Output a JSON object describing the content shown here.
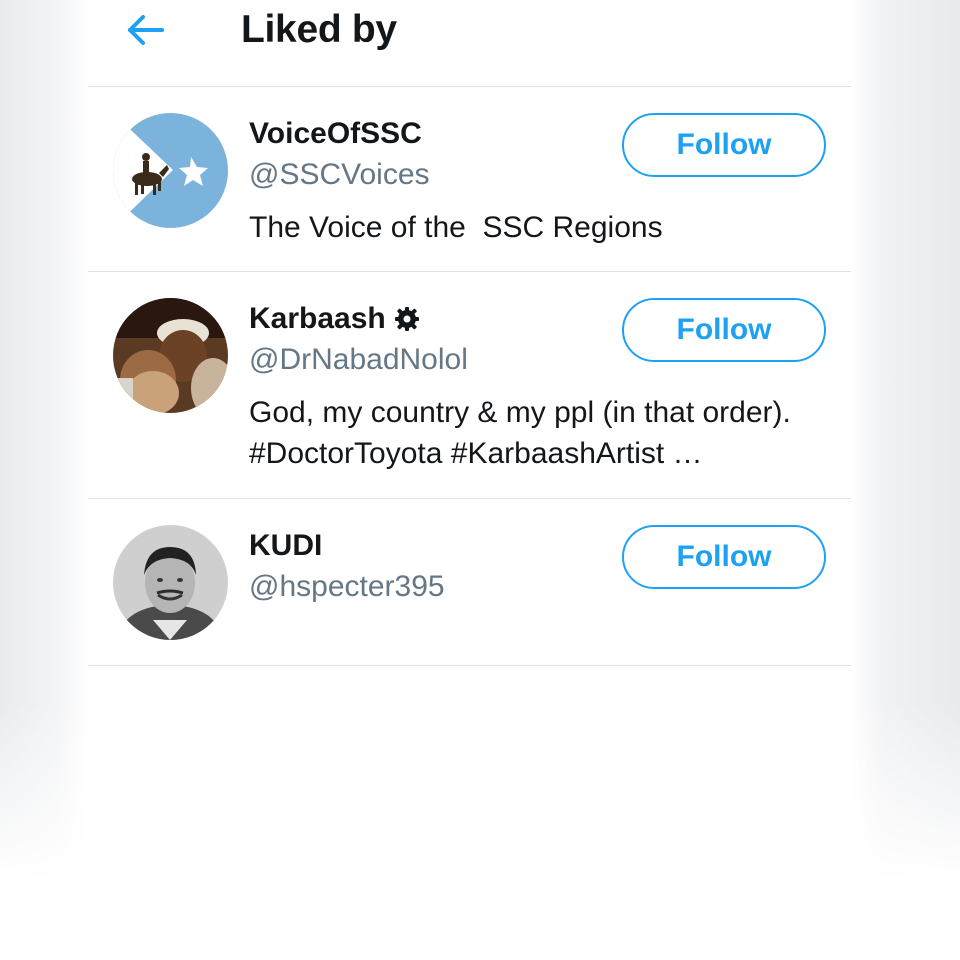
{
  "header": {
    "title": "Liked by",
    "back_icon": "back-arrow-icon"
  },
  "users": [
    {
      "name": "VoiceOfSSC",
      "handle": "@SSCVoices",
      "bio": "The Voice of the  SSC Regions",
      "follow_label": "Follow",
      "verified_badge": false
    },
    {
      "name": "Karbaash",
      "handle": "@DrNabadNolol",
      "bio": "God, my country & my ppl (in that order). #DoctorToyota #KarbaashArtist …",
      "follow_label": "Follow",
      "verified_badge": true,
      "badge_icon": "gear-badge-icon"
    },
    {
      "name": "KUDI",
      "handle": "@hspecter395",
      "bio": "",
      "follow_label": "Follow",
      "verified_badge": false
    }
  ],
  "colors": {
    "accent": "#1da1f2",
    "text_primary": "#14171a",
    "text_secondary": "#657786",
    "divider": "#dfe3e7"
  }
}
